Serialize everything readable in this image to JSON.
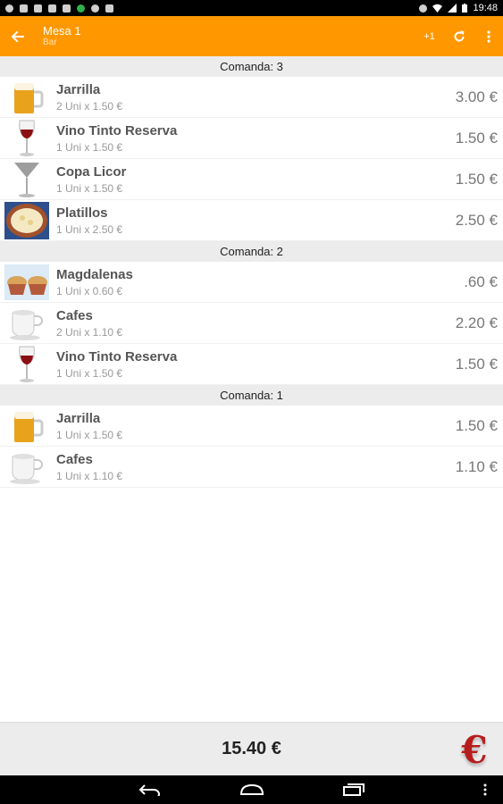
{
  "status_bar": {
    "time": "19:48"
  },
  "action_bar": {
    "title": "Mesa 1",
    "subtitle": "Bar",
    "plus_one_label": "+1"
  },
  "sections": [
    {
      "header": "Comanda: 3",
      "items": [
        {
          "name": "Jarrilla",
          "detail": "2 Uni x 1.50 €",
          "price": "3.00 €",
          "icon": "beer-mug-icon"
        },
        {
          "name": "Vino Tinto Reserva",
          "detail": "1 Uni x 1.50 €",
          "price": "1.50 €",
          "icon": "wine-glass-icon"
        },
        {
          "name": "Copa  Licor",
          "detail": "1 Uni x 1.50 €",
          "price": "1.50 €",
          "icon": "martini-glass-icon"
        },
        {
          "name": "Platillos",
          "detail": "1 Uni x 2.50 €",
          "price": "2.50 €",
          "icon": "plate-icon"
        }
      ]
    },
    {
      "header": "Comanda: 2",
      "items": [
        {
          "name": "Magdalenas",
          "detail": "1 Uni x 0.60 €",
          "price": ".60 €",
          "icon": "muffin-icon"
        },
        {
          "name": "Cafes",
          "detail": "2 Uni x 1.10 €",
          "price": "2.20 €",
          "icon": "coffee-cup-icon"
        },
        {
          "name": "Vino Tinto Reserva",
          "detail": "1 Uni x 1.50 €",
          "price": "1.50 €",
          "icon": "wine-glass-icon"
        }
      ]
    },
    {
      "header": "Comanda: 1",
      "items": [
        {
          "name": "Jarrilla",
          "detail": "1 Uni x 1.50 €",
          "price": "1.50 €",
          "icon": "beer-mug-icon"
        },
        {
          "name": "Cafes",
          "detail": "1 Uni x 1.10 €",
          "price": "1.10 €",
          "icon": "coffee-cup-icon"
        }
      ]
    }
  ],
  "footer": {
    "total": "15.40 €",
    "pay_glyph": "€"
  },
  "colors": {
    "accent": "#ff9800",
    "euro": "#b71c1c",
    "header_bg": "#ececec"
  }
}
